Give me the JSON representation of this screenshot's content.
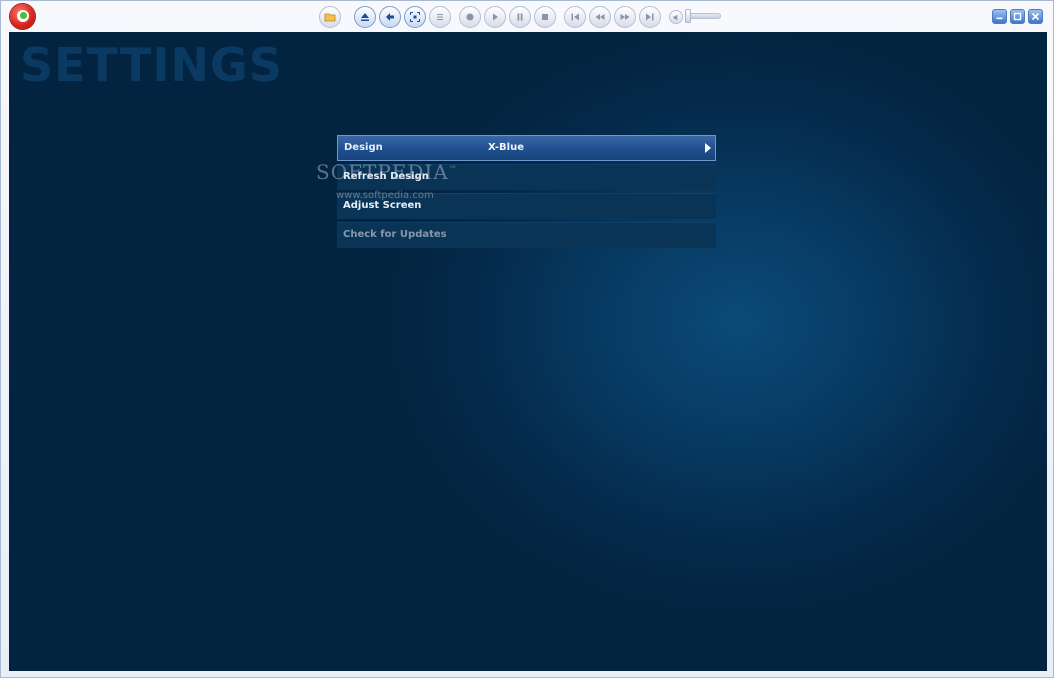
{
  "app": {
    "logo_icon": "app-logo-icon"
  },
  "toolbar": {
    "buttons": [
      {
        "name": "open-folder-button",
        "icon": "folder-open-icon"
      },
      {
        "name": "eject-button",
        "icon": "eject-icon"
      },
      {
        "name": "back-button",
        "icon": "back-arrow-icon"
      },
      {
        "name": "fullscreen-button",
        "icon": "fullscreen-icon"
      },
      {
        "name": "menu-button",
        "icon": "list-icon"
      },
      {
        "name": "record-button",
        "icon": "record-icon"
      },
      {
        "name": "play-button",
        "icon": "play-icon"
      },
      {
        "name": "pause-button",
        "icon": "pause-icon"
      },
      {
        "name": "stop-button",
        "icon": "stop-icon"
      },
      {
        "name": "previous-button",
        "icon": "skip-back-icon"
      },
      {
        "name": "rewind-button",
        "icon": "rewind-icon"
      },
      {
        "name": "fast-forward-button",
        "icon": "fast-forward-icon"
      },
      {
        "name": "next-button",
        "icon": "skip-forward-icon"
      }
    ],
    "volume_icon": "speaker-icon",
    "volume_level": 0.0
  },
  "window_controls": [
    "minimize",
    "maximize",
    "close"
  ],
  "page": {
    "title": "SETTINGS"
  },
  "menu": {
    "items": [
      {
        "label": "Design",
        "value": "X-Blue",
        "selected": true
      },
      {
        "label": "Refresh Design",
        "value": ""
      },
      {
        "label": "Adjust Screen",
        "value": ""
      },
      {
        "label": "Check for Updates",
        "value": "",
        "disabled": true
      }
    ]
  },
  "watermark": {
    "brand": "SOFTPEDIA",
    "tm": "™",
    "url": "www.softpedia.com"
  },
  "colors": {
    "background": "#042a4a",
    "selected_row": "#2a5a9a",
    "title": "#0a3a62",
    "window_frame": "#a9b8d3"
  }
}
